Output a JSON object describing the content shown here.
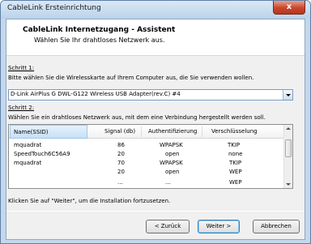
{
  "window": {
    "title": "CableLink Ersteinrichtung",
    "close_label": "x"
  },
  "header": {
    "title": "CableLink Internetzugang - Assistent",
    "subtitle": "Wählen Sie Ihr drahtloses Netzwerk aus."
  },
  "step1": {
    "label": "Schritt 1:",
    "text": "Bitte wählen Sie die Wirelesskarte auf Ihrem Computer aus, die Sie verwenden wollen.",
    "selected_adapter": "D-Link AirPlus G DWL-G122 Wireless USB Adapter(rev.C) #4"
  },
  "step2": {
    "label": "Schritt 2:",
    "text": "Wählen Sie ein drahtloses Netzwerk aus, mit dem eine Verbindung hergestellt werden soll."
  },
  "network_list": {
    "columns": [
      "Name(SSID)",
      "Signal (db)",
      "Authentifizierung",
      "Verschlüsselung"
    ],
    "rows": [
      [
        "mquadrat",
        "86",
        "WPAPSK",
        "TKIP"
      ],
      [
        "SpeedTouch6C56A9",
        "20",
        "open",
        "none"
      ],
      [
        "mquadrat",
        "70",
        "WPAPSK",
        "TKIP"
      ],
      [
        "",
        "20",
        "open",
        "WEP"
      ],
      [
        "",
        "...",
        "...",
        "WEP"
      ]
    ]
  },
  "footer": {
    "hint": "Klicken Sie auf \"Weiter\", um die Installation fortzusetzen.",
    "back_label": "< Zurück",
    "next_label": "Weiter >",
    "cancel_label": "Abbrechen"
  }
}
